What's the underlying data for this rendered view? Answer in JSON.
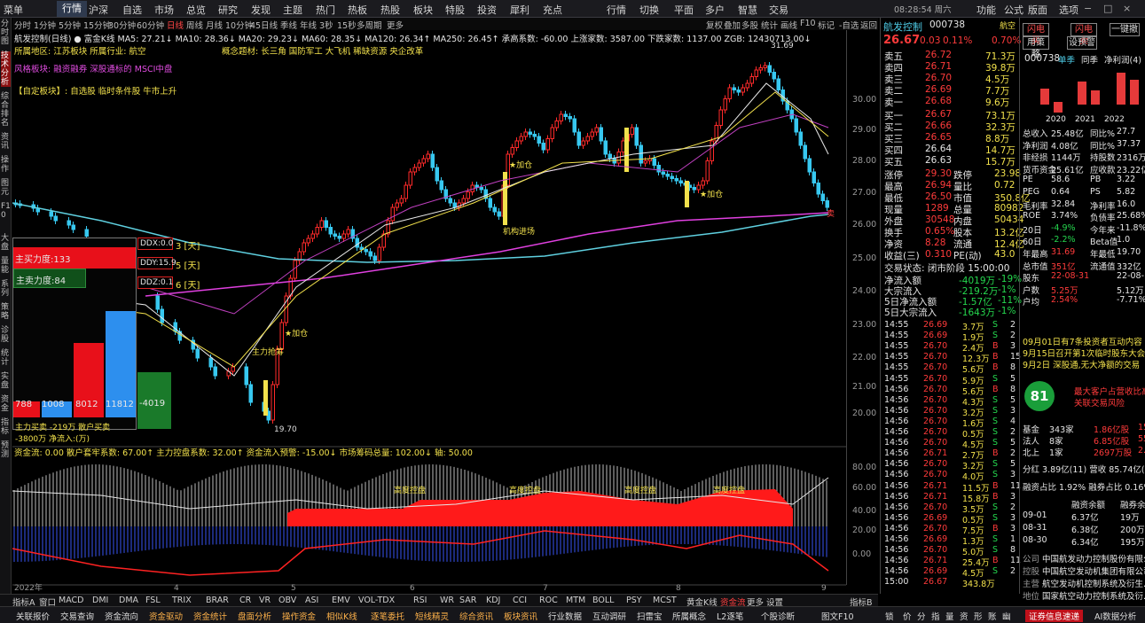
{
  "menu": [
    "菜单",
    "行情",
    "沪深",
    "自选",
    "市场",
    "总览",
    "研究",
    "发现",
    "主题",
    "热门",
    "热板",
    "热股",
    "板块",
    "特股",
    "投资",
    "犀利",
    "充点",
    "行情",
    "切换",
    "平面",
    "多户",
    "智慧",
    "交易",
    "功能",
    "公式",
    "版面",
    "选项"
  ],
  "clock": "08:28:54 周六",
  "subbar": [
    "分时",
    "1分钟",
    "5分钟",
    "15分钟",
    "30分钟",
    "60分钟",
    "日线",
    "周线",
    "月线",
    "10分钟",
    "45日线",
    "季线",
    "年线",
    "3秒",
    "15秒",
    "多周期",
    "更多",
    "复权",
    "叠加",
    "多股",
    "统计",
    "画线",
    "F10",
    "标记",
    "-自选",
    "返回"
  ],
  "leftnav": [
    "分时图",
    "技术分析",
    "综合排名",
    "资讯",
    "操作",
    "图元",
    "F10",
    "大盘",
    "量能",
    "系列",
    "策略",
    "诊股",
    "统计",
    "实盘",
    "资金",
    "指标",
    "预测"
  ],
  "info": {
    "line1": "航发控制(日线) ● 富金K线 MA5: 27.21↓ MA10: 28.36↓ MA20: 29.23↓ MA60: 28.35↓ MA120: 26.34↑ MA250: 26.45↑ 承高系数: -60.00 上涨家数: 3587.00 下跌家数: 1137.00 ZGB: 12430713.00↓",
    "line2": "所属地区: 江苏板块   所属行业: 航空",
    "line2b": "概念题材: 长三角  国防军工  大飞机  稀缺资源  央企改革",
    "line3": "风格板块: 融资融券 深股通标的 MSCI中盘",
    "line4": "【自定板块】: 自选股  临时条件股  牛市上升"
  },
  "ddbox": {
    "ddx": "DDX:0.0",
    "ddx_d": "3 [天]",
    "ddy": "DDY:15.9",
    "ddy_d": "5 [天]",
    "ddz": "DDZ:0.1",
    "ddz_d": "6 [天]",
    "buy": "主买力度:133",
    "sell": "主卖力度:84",
    "v1": "788",
    "v2": "1008",
    "v3": "8012",
    "v4": "11812",
    "v5": "-4019",
    "foot": "主力买卖 -219万   散户买卖 -3800万 净流入:(万)"
  },
  "yaxis": [
    "30.00",
    "29.00",
    "28.00",
    "27.00",
    "26.00",
    "25.00",
    "24.00",
    "23.00",
    "22.00",
    "21.00",
    "20.00"
  ],
  "sub_y": [
    "80.00",
    "60.00",
    "40.00",
    "20.00",
    "0.00"
  ],
  "subinfo": "资金流: 0.00  散户套牢系数: 67.00↑  主力控盘系数: 32.00↑  资金流入预警: -15.00↓  市场筹码总量: 102.00↓  轴: 50.00",
  "chart_labels": {
    "high": "31.69",
    "low": "19.70",
    "a1": "★加仓",
    "a2": "机构进场",
    "a3": "★加仓",
    "a4": "主力抢筹",
    "a5": "卖",
    "a6": "★加仓",
    "sub1": "高度控盘",
    "sub2": "高度控盘",
    "sub3": "高度控盘",
    "sub4": "高度控盘",
    "year": "2022年",
    "m4": "4",
    "m5": "5",
    "m6": "6",
    "m7": "7",
    "m8": "8",
    "m9": "9",
    "daily": "日线"
  },
  "stock": {
    "name": "航发控制",
    "code": "000738",
    "tag": "航空",
    "price": "26.67",
    "chg": "0.03",
    "pct": "0.11%",
    "ratio": "0.70%"
  },
  "book": {
    "sell": [
      [
        "卖五",
        "26.72",
        "71.3万"
      ],
      [
        "卖四",
        "26.71",
        "39.8万"
      ],
      [
        "卖三",
        "26.70",
        "4.5万"
      ],
      [
        "卖二",
        "26.69",
        "7.7万"
      ],
      [
        "卖一",
        "26.68",
        "9.6万"
      ]
    ],
    "buy": [
      [
        "买一",
        "26.67",
        "73.1万"
      ],
      [
        "买二",
        "26.66",
        "32.3万"
      ],
      [
        "买三",
        "26.65",
        "8.8万"
      ],
      [
        "买四",
        "26.64",
        "14.7万"
      ],
      [
        "买五",
        "26.63",
        "15.7万"
      ]
    ]
  },
  "stats": [
    [
      "涨停",
      "29.30",
      "跌停",
      "23.98"
    ],
    [
      "最高",
      "26.94",
      "量比",
      "0.72"
    ],
    [
      "最低",
      "26.50",
      "市值",
      "350.8亿"
    ],
    [
      "现量",
      "1289",
      "总量",
      "80982"
    ],
    [
      "外盘",
      "30548",
      "内盘",
      "50434"
    ],
    [
      "换手",
      "0.65%",
      "股本",
      "13.2亿"
    ],
    [
      "净资",
      "8.28",
      "流通",
      "12.4亿"
    ],
    [
      "收益(三)",
      "0.310",
      "PE(动)",
      "43.0"
    ]
  ],
  "tradestate": "交易状态: 闭市阶段 15:00:00",
  "flows": [
    [
      "净流入额",
      "-4019万",
      "-19%"
    ],
    [
      "大宗流入",
      "-219.2万",
      "-1%"
    ],
    [
      "5日净流入额",
      "-1.57亿",
      "-11%"
    ],
    [
      "5日大宗流入",
      "-1643万",
      "-1%"
    ]
  ],
  "ticks": [
    [
      "14:55",
      "26.69",
      "3.7万",
      "S",
      "2"
    ],
    [
      "14:55",
      "26.69",
      "1.9万",
      "S",
      "2"
    ],
    [
      "14:55",
      "26.70",
      "2.4万",
      "B",
      "3"
    ],
    [
      "14:55",
      "26.70",
      "12.3万",
      "B",
      "15"
    ],
    [
      "14:55",
      "26.70",
      "5.6万",
      "B",
      "8"
    ],
    [
      "14:55",
      "26.70",
      "5.9万",
      "S",
      "5"
    ],
    [
      "14:56",
      "26.70",
      "5.6万",
      "B",
      "8"
    ],
    [
      "14:56",
      "26.70",
      "4.3万",
      "S",
      "5"
    ],
    [
      "14:56",
      "26.70",
      "3.2万",
      "S",
      "3"
    ],
    [
      "14:56",
      "26.70",
      "1.6万",
      "S",
      "4"
    ],
    [
      "14:56",
      "26.70",
      "0.5万",
      "S",
      "2"
    ],
    [
      "14:56",
      "26.70",
      "4.5万",
      "S",
      "5"
    ],
    [
      "14:56",
      "26.71",
      "2.7万",
      "B",
      "2"
    ],
    [
      "14:56",
      "26.70",
      "3.2万",
      "S",
      "5"
    ],
    [
      "14:56",
      "26.70",
      "4.0万",
      "S",
      "3"
    ],
    [
      "14:56",
      "26.71",
      "11.5万",
      "B",
      "11"
    ],
    [
      "14:56",
      "26.71",
      "15.8万",
      "B",
      "3"
    ],
    [
      "14:56",
      "26.70",
      "3.5万",
      "S",
      "2"
    ],
    [
      "14:56",
      "26.69",
      "0.5万",
      "S",
      "3"
    ],
    [
      "14:56",
      "26.70",
      "7.5万",
      "B",
      "3"
    ],
    [
      "14:56",
      "26.69",
      "1.3万",
      "S",
      "1"
    ],
    [
      "14:56",
      "26.70",
      "5.0万",
      "S",
      "8"
    ],
    [
      "14:56",
      "26.71",
      "25.4万",
      "B",
      "11"
    ],
    [
      "14:56",
      "26.69",
      "4.5万",
      "S",
      "2"
    ],
    [
      "15:00",
      "26.67",
      "343.8万",
      "",
      ""
    ]
  ],
  "far": {
    "btns": [
      "闪电买",
      "闪电卖",
      "一键撤",
      "用策略",
      "设预警"
    ],
    "code": "000738",
    "tabs": [
      "单季",
      "同季",
      "净利润(4)"
    ],
    "years": [
      "2020",
      "2021",
      "2022"
    ],
    "fin": [
      [
        "总收入",
        "25.48亿",
        "同比%",
        "27.7"
      ],
      [
        "净利润",
        "4.08亿",
        "同比%",
        "37.37"
      ],
      [
        "非经损",
        "1144万",
        "持股数",
        "2316万"
      ],
      [
        "货币资金",
        "25.61亿",
        "应收款",
        "23.22亿"
      ],
      [
        "PE",
        "58.6",
        "PB",
        "3.22"
      ],
      [
        "PEG",
        "0.64",
        "PS",
        "5.82"
      ],
      [
        "毛利率",
        "32.84",
        "净利率",
        "16.0"
      ],
      [
        "ROE",
        "3.74%",
        "负债率",
        "25.68%"
      ],
      [
        "20日",
        "-4.9%",
        "今年来",
        "-11.8%"
      ],
      [
        "60日",
        "-2.2%",
        "Beta值",
        "1.0"
      ],
      [
        "年最高",
        "31.69",
        "年最低",
        "19.70"
      ],
      [
        "总市值",
        "351亿",
        "流通值",
        "332亿"
      ],
      [
        "股东",
        "22-08-31",
        "",
        "22-08-10"
      ],
      [
        "户数",
        "5.25万",
        "",
        "5.12万"
      ],
      [
        "户均",
        "2.54%",
        "",
        "-7.71%"
      ]
    ],
    "news": [
      "09月01日有7条投资者互动内容",
      "9月15日召开第1次临时股东大会",
      "9月2日 深股通,无大净额的交易"
    ],
    "score": "81",
    "scoretxt": [
      "最大客户占营收比高",
      "关联交易风险"
    ],
    "hold": [
      [
        "基金",
        "343家",
        "1.86亿股",
        "15.09"
      ],
      [
        "法人",
        "8家",
        "6.85亿股",
        "55.19"
      ],
      [
        "北上",
        "1家",
        "2697万股",
        "2.29"
      ]
    ],
    "margin1": "分红  3.89亿(11)  营收  85.74亿(3)",
    "margin2": "融资占比  1.92%  融券占比  0.16%",
    "mtitle": [
      "",
      "融资余额",
      "融券余额"
    ],
    "mrows": [
      [
        "09-01",
        "6.37亿",
        "19万"
      ],
      [
        "08-31",
        "6.38亿",
        "200万"
      ],
      [
        "08-30",
        "6.34亿",
        "195万"
      ]
    ],
    "corp": [
      [
        "公司",
        "中国航发动力控制股份有限公司"
      ],
      [
        "控股",
        "中国航空发动机集团有限公司"
      ],
      [
        "主营",
        "航空发动机控制系统及衍生..."
      ],
      [
        "地位",
        "国家航空动力控制系统及衍..."
      ]
    ]
  },
  "btmtabs": [
    "指标A",
    "窗口",
    "MACD",
    "DMI",
    "DMA",
    "FSL",
    "TRIX",
    "BRAR",
    "CR",
    "VR",
    "OBV",
    "ASI",
    "EMV",
    "VOL-TDX",
    "RSI",
    "WR",
    "SAR",
    "KDJ",
    "CCI",
    "ROC",
    "MTM",
    "BOLL",
    "PSY",
    "MCST",
    "黄金K线",
    "资金流",
    "更多",
    "设置"
  ],
  "btmright": "指标B",
  "status": [
    "关联报价",
    "交易查询",
    "资金流向",
    "资金驱动",
    "资金统计",
    "盘面分析",
    "操作资金",
    "相似K线",
    "逐笔委托",
    "短线精灵",
    "综合资讯",
    "板块资讯",
    "行业数据",
    "互动调研",
    "扫雷宝",
    "所属概念",
    "L2逐笔",
    "个股诊断"
  ],
  "status_right": [
    "图文F10",
    "锁",
    "价",
    "分",
    "指",
    "量",
    "资",
    "形",
    "账",
    "幽",
    "证券信息速递",
    "AI数据分析"
  ]
}
